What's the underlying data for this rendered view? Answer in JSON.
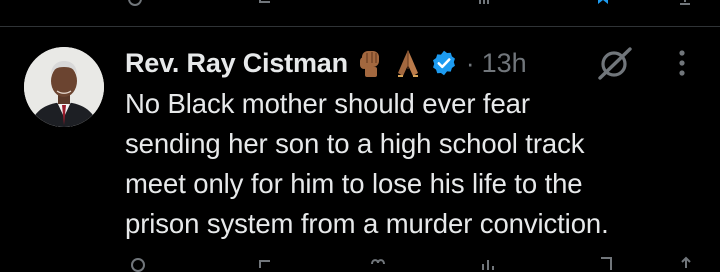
{
  "tweet": {
    "display_name": "Rev. Ray Cistman",
    "name_emojis": [
      "raised-fist-emoji",
      "folded-hands-emoji"
    ],
    "verified": true,
    "separator": "·",
    "timestamp": "13h",
    "text": "No Black mother should ever fear\nsending her son to a high school track\nmeet only for him to lose his life to the\nprison system from a murder conviction."
  },
  "icons": {
    "verified": "verified-badge-icon",
    "grok": "grok-icon",
    "more": "more-options-icon"
  },
  "colors": {
    "background": "#000000",
    "text": "#e7e9ea",
    "secondary": "#71767b",
    "verified": "#1d9bf0",
    "divider": "#2f3336"
  }
}
